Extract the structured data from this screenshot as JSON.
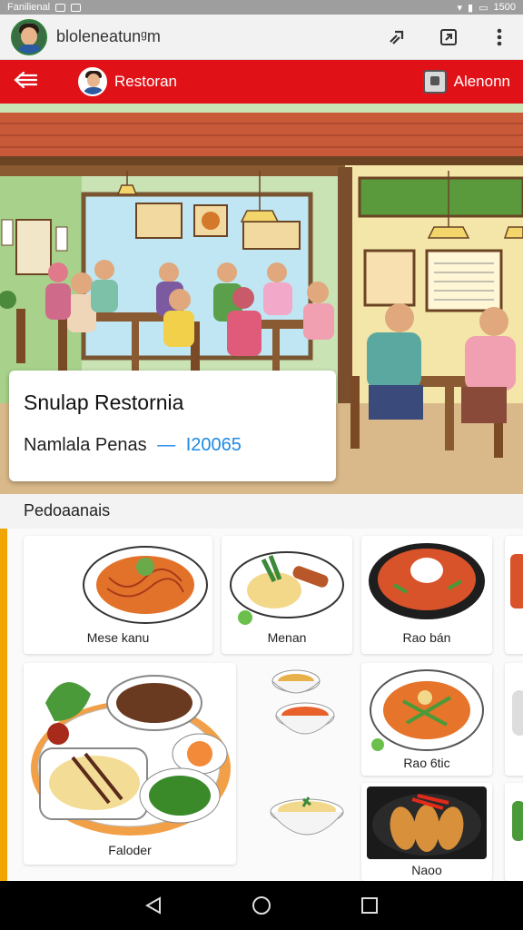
{
  "status_bar": {
    "left_text": "Fanilienal",
    "time": "1500"
  },
  "app_bar": {
    "title": "bloleneatunᵍm",
    "icons": [
      "share-icon",
      "open-in-icon",
      "more-vert-icon"
    ]
  },
  "header": {
    "back_icon": "arrow-left-icon",
    "left_label": "Restoran",
    "right_label": "Alenonn",
    "accent_color": "#e01218"
  },
  "restaurant": {
    "name": "Snulap Restornia",
    "subtitle": "Namlala Penas",
    "dash": "—",
    "number": "I20065"
  },
  "section_title": "Pedoaanais",
  "menu": {
    "items": [
      {
        "label": "Mese kanu"
      },
      {
        "label": "Menan"
      },
      {
        "label": "Rao bán"
      },
      {
        "label": "Faloder"
      },
      {
        "label": "Rao 6tic"
      },
      {
        "label": "Naoo"
      }
    ]
  },
  "nav": {
    "icons": [
      "back-triangle-icon",
      "home-circle-icon",
      "recents-square-icon"
    ]
  }
}
